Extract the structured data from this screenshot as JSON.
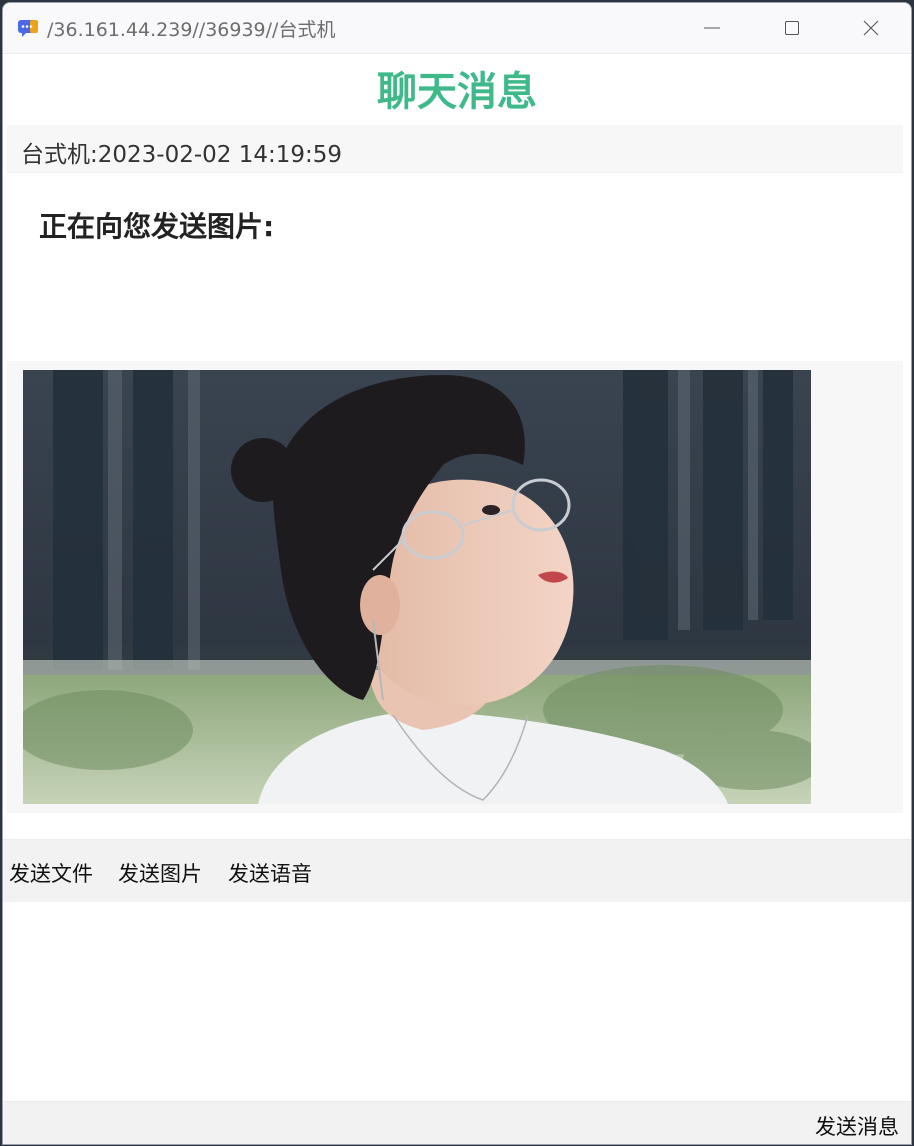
{
  "window": {
    "title": "/36.161.44.239//36939//台式机",
    "icon": "chat-app-icon",
    "controls": [
      "minimize-icon",
      "maximize-icon",
      "close-icon"
    ]
  },
  "chat": {
    "heading": "聊天消息",
    "heading_color": "#3fb98a",
    "message": {
      "sender_line": "台式机:2023-02-02 14:19:59",
      "text": "正在向您发送图片:"
    }
  },
  "toolbar": {
    "send_file": "发送文件",
    "send_image": "发送图片",
    "send_voice": "发送语音"
  },
  "composer": {
    "value": "",
    "send_label": "发送消息"
  }
}
